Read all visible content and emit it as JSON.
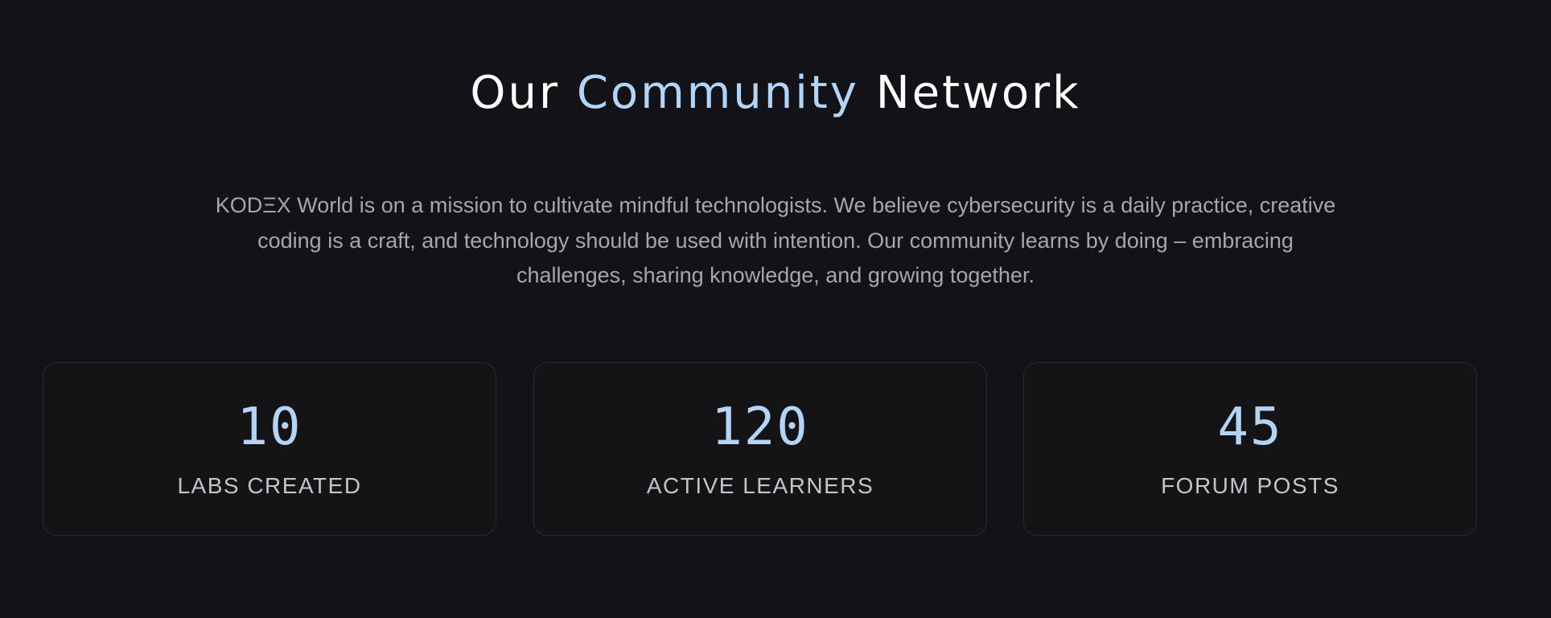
{
  "heading": {
    "part1": "Our ",
    "accent": "Community",
    "part2": " Network"
  },
  "mission": "KODΞX World is on a mission to cultivate mindful technologists. We believe cybersecurity is a daily practice, creative coding is a craft, and technology should be used with intention. Our community learns by doing – embracing challenges, sharing knowledge, and growing together.",
  "stats": [
    {
      "value": "10",
      "label": "LABS CREATED"
    },
    {
      "value": "120",
      "label": "ACTIVE LEARNERS"
    },
    {
      "value": "45",
      "label": "FORUM POSTS"
    }
  ],
  "colors": {
    "background": "#131317",
    "accent": "#b4d4f7",
    "heading": "#ffffff",
    "body_text": "#a4a7ae",
    "card_border": "#2a2b30"
  }
}
